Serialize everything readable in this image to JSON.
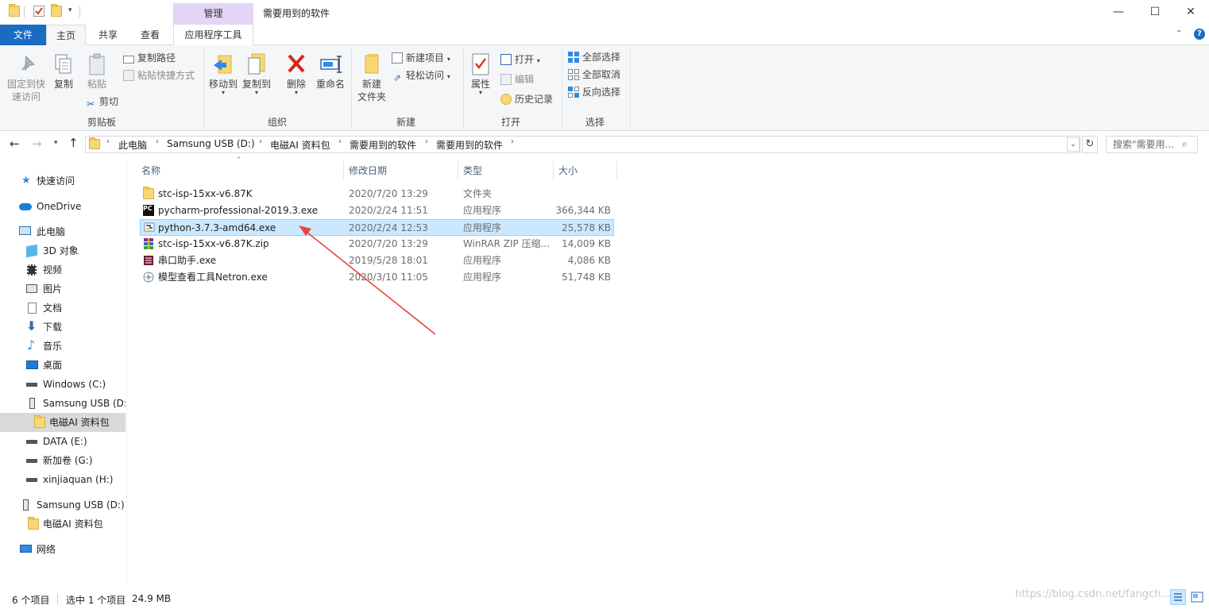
{
  "window": {
    "title": "需要用到的软件",
    "context_tab": "管理",
    "controls": {
      "minimize": "—",
      "maximize": "☐",
      "close": "✕"
    }
  },
  "tabs": {
    "file": "文件",
    "home": "主页",
    "share": "共享",
    "view": "查看",
    "app_tools": "应用程序工具"
  },
  "ribbon": {
    "clipboard": {
      "pin": "固定到快\n速访问",
      "copy": "复制",
      "paste": "粘贴",
      "copy_path": "复制路径",
      "paste_shortcut": "粘贴快捷方式",
      "cut": "剪切",
      "label": "剪贴板"
    },
    "organize": {
      "move_to": "移动到",
      "copy_to": "复制到",
      "delete": "删除",
      "rename": "重命名",
      "label": "组织"
    },
    "new": {
      "new_folder": "新建\n文件夹",
      "new_item": "新建项目",
      "easy_access": "轻松访问",
      "label": "新建"
    },
    "open": {
      "properties": "属性",
      "open": "打开",
      "edit": "编辑",
      "history": "历史记录",
      "label": "打开"
    },
    "select": {
      "select_all": "全部选择",
      "select_none": "全部取消",
      "invert": "反向选择",
      "label": "选择"
    }
  },
  "address": {
    "crumbs": [
      "此电脑",
      "Samsung USB (D:)",
      "电磁AI 资料包",
      "需要用到的软件",
      "需要用到的软件"
    ],
    "search_placeholder": "搜索\"需要用..."
  },
  "nav": {
    "quick_access": "快速访问",
    "onedrive": "OneDrive",
    "this_pc": "此电脑",
    "items": [
      {
        "label": "3D 对象"
      },
      {
        "label": "视频"
      },
      {
        "label": "图片"
      },
      {
        "label": "文档"
      },
      {
        "label": "下载"
      },
      {
        "label": "音乐"
      },
      {
        "label": "桌面"
      },
      {
        "label": "Windows (C:)"
      },
      {
        "label": "Samsung USB (D:)"
      },
      {
        "label": "电磁AI 资料包"
      },
      {
        "label": "DATA (E:)"
      },
      {
        "label": "新加卷 (G:)"
      },
      {
        "label": "xinjiaquan (H:)"
      }
    ],
    "usb": "Samsung USB (D:)",
    "usb_folder": "电磁AI 资料包",
    "network": "网络"
  },
  "columns": {
    "name": "名称",
    "date": "修改日期",
    "type": "类型",
    "size": "大小"
  },
  "files": [
    {
      "name": "stc-isp-15xx-v6.87K",
      "date": "2020/7/20 13:29",
      "type": "文件夹",
      "size": "",
      "icon": "folder-icon"
    },
    {
      "name": "pycharm-professional-2019.3.exe",
      "date": "2020/2/24 11:51",
      "type": "应用程序",
      "size": "366,344 KB",
      "icon": "pycharm-icon"
    },
    {
      "name": "python-3.7.3-amd64.exe",
      "date": "2020/2/24 12:53",
      "type": "应用程序",
      "size": "25,578 KB",
      "icon": "python-installer-icon",
      "selected": true
    },
    {
      "name": "stc-isp-15xx-v6.87K.zip",
      "date": "2020/7/20 13:29",
      "type": "WinRAR ZIP 压缩...",
      "size": "14,009 KB",
      "icon": "winrar-icon"
    },
    {
      "name": "串口助手.exe",
      "date": "2019/5/28 18:01",
      "type": "应用程序",
      "size": "4,086 KB",
      "icon": "serial-tool-icon"
    },
    {
      "name": "模型查看工具Netron.exe",
      "date": "2020/3/10 11:05",
      "type": "应用程序",
      "size": "51,748 KB",
      "icon": "netron-icon"
    }
  ],
  "status": {
    "count": "6 个项目",
    "selected": "选中 1 个项目",
    "size": "24.9 MB"
  },
  "watermark": "https://blog.csdn.net/fangch...",
  "colors": {
    "accent": "#1a6bc4",
    "selection": "#cce8ff",
    "context": "#e4d4f5",
    "arrow": "#e8453c"
  }
}
